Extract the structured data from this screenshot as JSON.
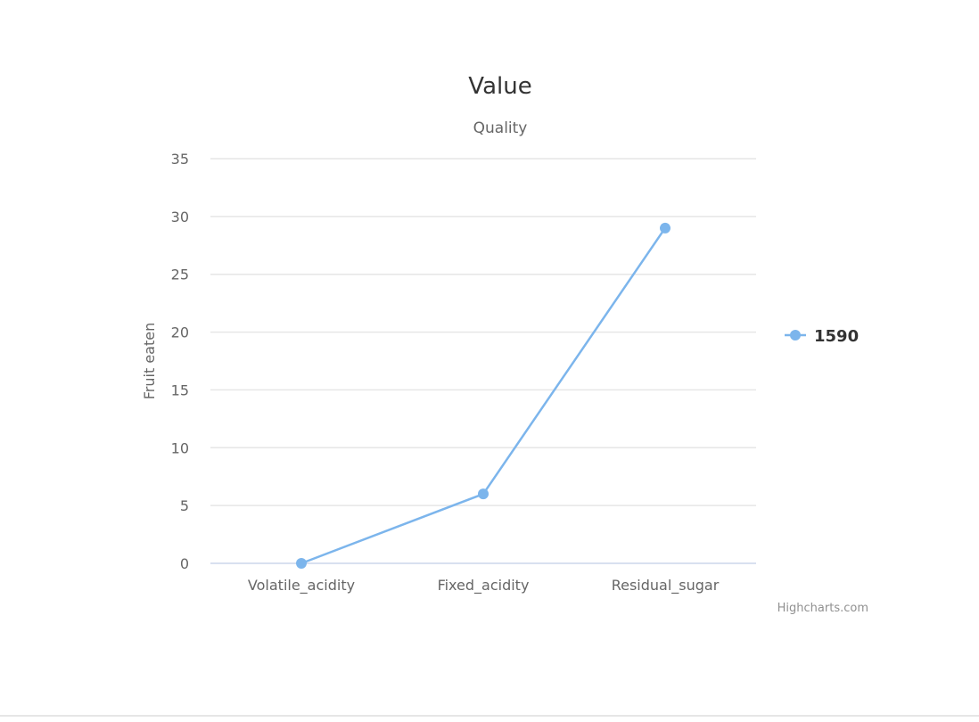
{
  "chart_data": {
    "type": "line",
    "title": "Value",
    "subtitle": "Quality",
    "xlabel": "",
    "ylabel": "Fruit eaten",
    "categories": [
      "Volatile_acidity",
      "Fixed_acidity",
      "Residual_sugar"
    ],
    "series": [
      {
        "name": "1590",
        "values": [
          0,
          6,
          29
        ],
        "color": "#7cb5ec"
      }
    ],
    "ylim": [
      0,
      35
    ],
    "yticks": [
      "0",
      "5",
      "10",
      "15",
      "20",
      "25",
      "30",
      "35"
    ],
    "grid": true,
    "legend_position": "right",
    "credits": "Highcharts.com"
  },
  "colors": {
    "series": "#7cb5ec",
    "grid": "#e6e6e6",
    "axis_line": "#ccd6eb",
    "title": "#333333",
    "labels": "#666666"
  }
}
